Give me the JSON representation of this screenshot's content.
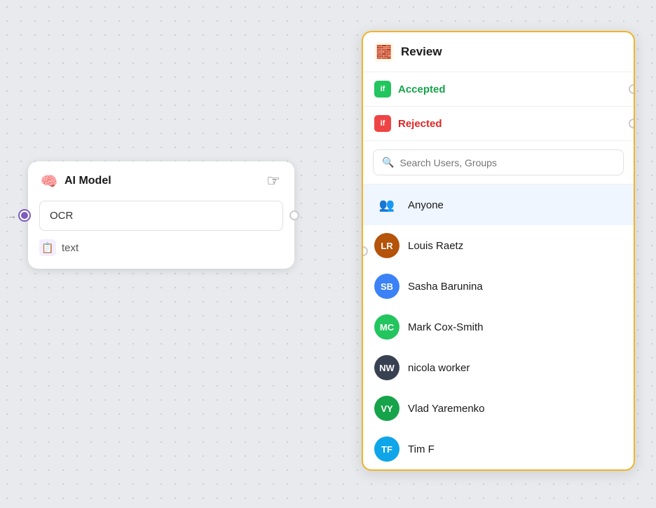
{
  "aiNode": {
    "title": "AI Model",
    "ocrValue": "OCR",
    "textLabel": "text",
    "handCursor": "👆"
  },
  "reviewPanel": {
    "title": "Review",
    "icon": "🧱",
    "conditions": [
      {
        "id": "accepted",
        "badge": "if",
        "label": "Accepted",
        "color": "green"
      },
      {
        "id": "rejected",
        "badge": "if",
        "label": "Rejected",
        "color": "red"
      }
    ],
    "search": {
      "placeholder": "Search Users, Groups"
    },
    "users": [
      {
        "id": "anyone",
        "name": "Anyone",
        "initials": "",
        "color": "",
        "type": "anyone"
      },
      {
        "id": "lr",
        "name": "Louis Raetz",
        "initials": "LR",
        "color": "#b45309"
      },
      {
        "id": "sb",
        "name": "Sasha Barunina",
        "initials": "SB",
        "color": "#3b82f6"
      },
      {
        "id": "mc",
        "name": "Mark Cox-Smith",
        "initials": "MC",
        "color": "#22c55e"
      },
      {
        "id": "nw",
        "name": "nicola worker",
        "initials": "NW",
        "color": "#374151"
      },
      {
        "id": "vy",
        "name": "Vlad Yaremenko",
        "initials": "VY",
        "color": "#16a34a"
      },
      {
        "id": "tf",
        "name": "Tim F",
        "initials": "TF",
        "color": "#0ea5e9"
      }
    ]
  },
  "colors": {
    "accent": "#f0b429",
    "purple": "#7c5cbf",
    "green": "#22c55e",
    "red": "#ef4444"
  }
}
